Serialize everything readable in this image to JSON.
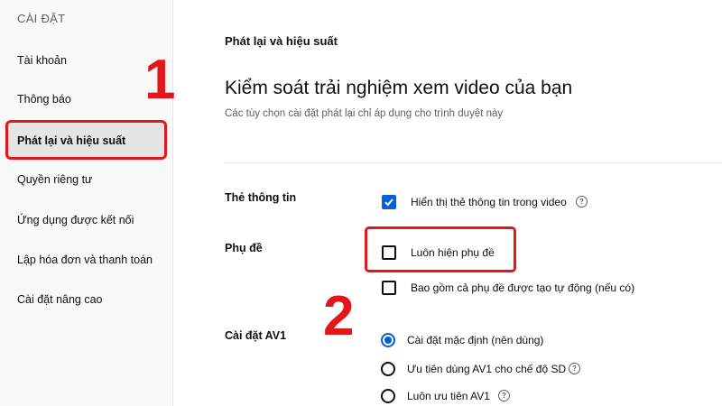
{
  "sidebar": {
    "title": "CÀI ĐẶT",
    "items": [
      {
        "label": "Tài khoản"
      },
      {
        "label": "Thông báo"
      },
      {
        "label": "Phát lại và hiệu suất"
      },
      {
        "label": "Quyền riêng tư"
      },
      {
        "label": "Ứng dụng được kết nối"
      },
      {
        "label": "Lập hóa đơn và thanh toán"
      },
      {
        "label": "Cài đặt nâng cao"
      }
    ],
    "active_index": 2
  },
  "annotations": {
    "step1": "1",
    "step2": "2"
  },
  "main": {
    "section_heading": "Phát lại và hiệu suất",
    "title": "Kiểm soát trải nghiệm xem video của bạn",
    "subtitle": "Các tùy chọn cài đặt phát lại chỉ áp dụng cho trình duyệt này",
    "info_cards": {
      "label": "Thẻ thông tin",
      "option": {
        "text": "Hiển thị thẻ thông tin trong video",
        "checked": true
      }
    },
    "subtitles": {
      "label": "Phụ đề",
      "options": [
        {
          "text": "Luôn hiện phụ đề",
          "checked": false
        },
        {
          "text": "Bao gồm cả phụ đề được tạo tự động (nếu có)",
          "checked": false
        }
      ]
    },
    "av1": {
      "label": "Cài đặt AV1",
      "options": [
        {
          "text": "Cài đặt mặc định (nên dùng)",
          "selected": true
        },
        {
          "text": "Ưu tiên dùng AV1 cho chế độ SD",
          "selected": false
        },
        {
          "text": "Luôn ưu tiên AV1",
          "selected": false
        }
      ]
    },
    "help_glyph": "?"
  },
  "colors": {
    "accent_blue": "#065fd4",
    "annotation_red": "#e3161c",
    "sidebar_bg": "#f9f9f9"
  }
}
